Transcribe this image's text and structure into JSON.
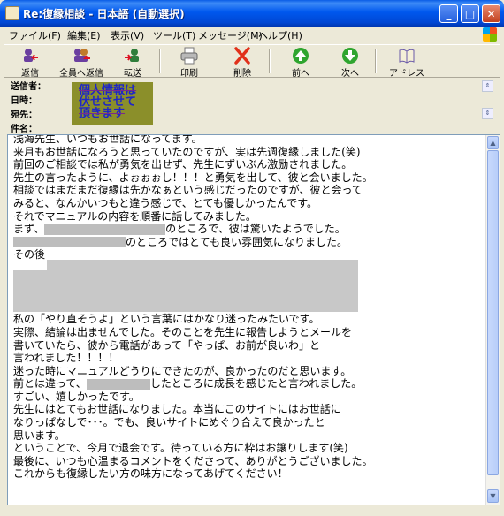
{
  "window": {
    "title": "Re:復縁相談 - 日本語 (自動選択)"
  },
  "menu": [
    "ファイル(F)",
    "編集(E)",
    "表示(V)",
    "ツール(T)",
    "メッセージ(M)",
    "ヘルプ(H)"
  ],
  "toolbar": {
    "reply": "返信",
    "reply_all": "全員へ返信",
    "forward": "転送",
    "print": "印刷",
    "delete": "削除",
    "prev": "前へ",
    "next": "次へ",
    "address": "アドレス"
  },
  "header": {
    "from_label": "送信者：",
    "date_label": "日時：",
    "to_label": "宛先：",
    "subject_label": "件名：",
    "stamp": [
      "個人情報は",
      "伏せさせて",
      "頂きます"
    ]
  },
  "body": {
    "l1": "浅海先生、いつもお世話になってます。",
    "l2": "来月もお世話になろうと思っていたのですが、実は先週復縁しました(笑)",
    "l3": "前回のご相談では私が勇気を出せず、先生にずいぶん激励されました。",
    "l4": "先生の言ったように、よぉぉぉし！！！と勇気を出して、彼と会いました。",
    "l5": "相談ではまだまだ復縁は先かなぁという感じだったのですが、彼と会って",
    "l6": "みると、なんかいつもと違う感じで、とても優しかったんです。",
    "l7": "それでマニュアルの内容を順番に話してみました。",
    "l8a": "まず、",
    "l8b": "のところで、彼は驚いたようでした。",
    "l9b": "のところではとても良い雰囲気になりました。",
    "l10": "その後",
    "l11": "私の「やり直そうよ」という言葉にはかなり迷ったみたいです。",
    "l12": "実際、結論は出ませんでした。そのことを先生に報告しようとメールを",
    "l13": "書いていたら、彼から電話があって「やっぱ、お前が良いわ」と",
    "l14": "言われました！！！！",
    "l15": "迷った時にマニュアルどうりにできたのが、良かったのだと思います。",
    "l16a": "前とは違って、",
    "l16b": "したところに成長を感じたと言われました。",
    "l17": "すごい、嬉しかったです。",
    "l18": "先生にはとてもお世話になりました。本当にこのサイトにはお世話に",
    "l19": "なりっぱなしで･･･。でも、良いサイトにめぐり合えて良かったと",
    "l20": "思います。",
    "l21": "ということで、今月で退会です。待っている方に枠はお譲りします(笑)",
    "l22": "最後に、いつも心温まるコメントをくださって、ありがとうございました。",
    "l23": "これからも復縁したい方の味方になってあげてください！"
  }
}
